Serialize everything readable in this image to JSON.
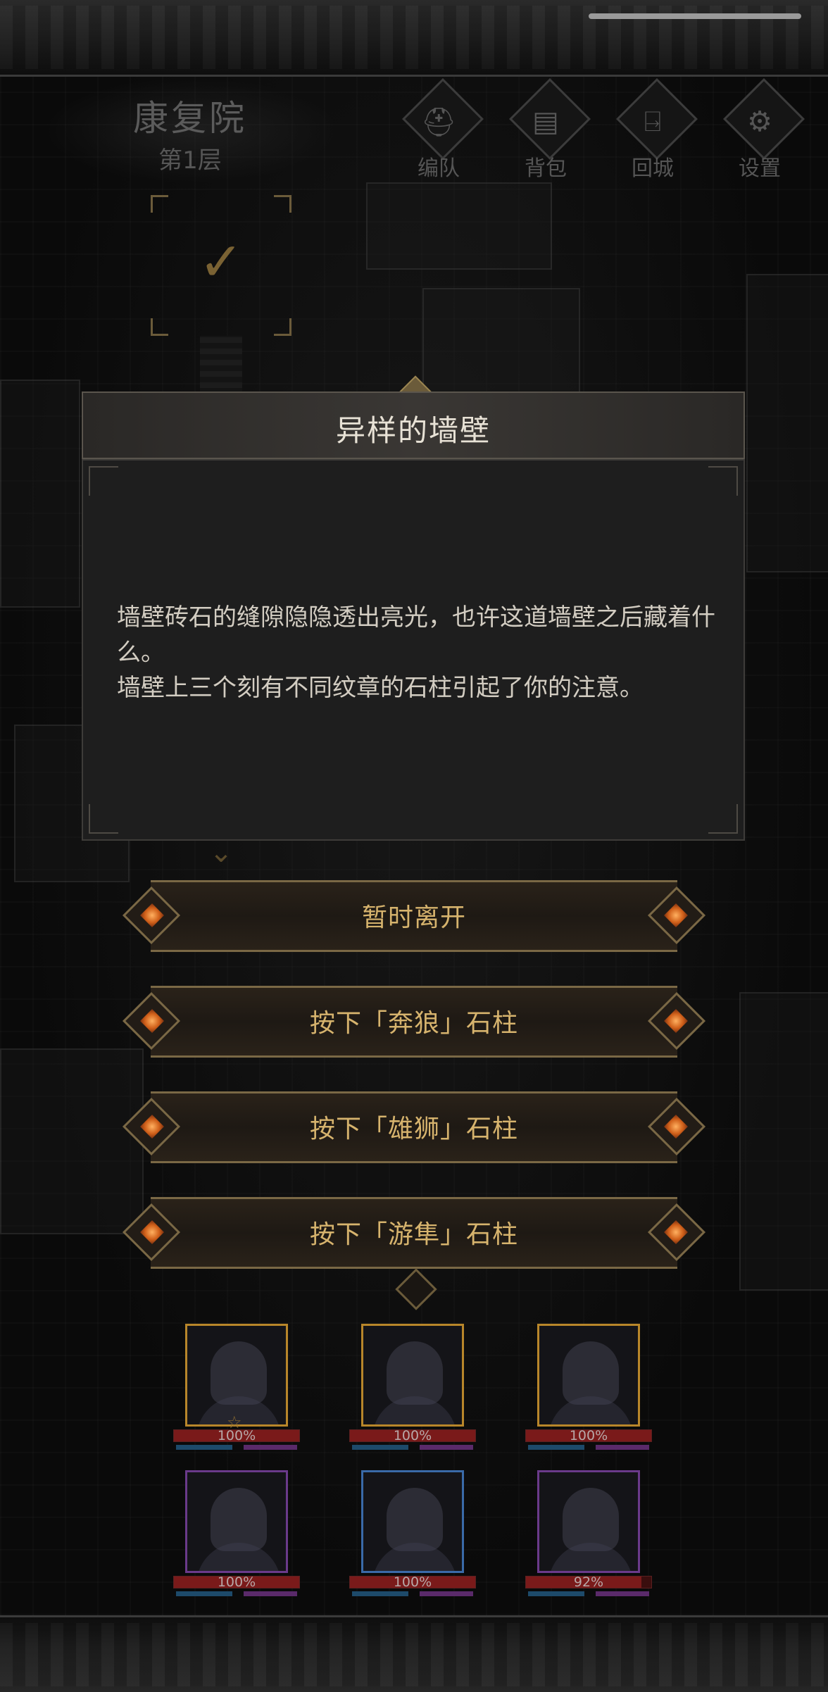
{
  "header": {
    "location_name": "康复院",
    "floor_label": "第1层"
  },
  "menu": [
    {
      "label": "编队",
      "icon": "helmet-icon",
      "glyph": "⛑"
    },
    {
      "label": "背包",
      "icon": "backpack-icon",
      "glyph": "▤"
    },
    {
      "label": "回城",
      "icon": "door-exit-icon",
      "glyph": "⍈"
    },
    {
      "label": "设置",
      "icon": "gear-icon",
      "glyph": "⚙"
    }
  ],
  "map": {
    "checkpoint_glyph": "✓",
    "chevron_glyph": "⌄"
  },
  "event": {
    "title": "异样的墙壁",
    "lines": [
      "墙壁砖石的缝隙隐隐透出亮光，也许这道墙壁之后藏着什么。",
      "墙壁上三个刻有不同纹章的石柱引起了你的注意。"
    ]
  },
  "choices": [
    {
      "label": "暂时离开"
    },
    {
      "label": "按下「奔狼」石柱"
    },
    {
      "label": "按下「雄狮」石柱"
    },
    {
      "label": "按下「游隼」石柱"
    }
  ],
  "party": [
    {
      "hp_text": "100%",
      "hp": 1.0,
      "frame_color": "#b8862a",
      "leader": true,
      "leader_glyph": "☆"
    },
    {
      "hp_text": "100%",
      "hp": 1.0,
      "frame_color": "#b8862a",
      "leader": false
    },
    {
      "hp_text": "100%",
      "hp": 1.0,
      "frame_color": "#b8862a",
      "leader": false
    },
    {
      "hp_text": "100%",
      "hp": 1.0,
      "frame_color": "#6a3a8a",
      "leader": false
    },
    {
      "hp_text": "100%",
      "hp": 1.0,
      "frame_color": "#3a6aa8",
      "leader": false
    },
    {
      "hp_text": "92%",
      "hp": 0.92,
      "frame_color": "#6a3a8a",
      "leader": false
    }
  ]
}
